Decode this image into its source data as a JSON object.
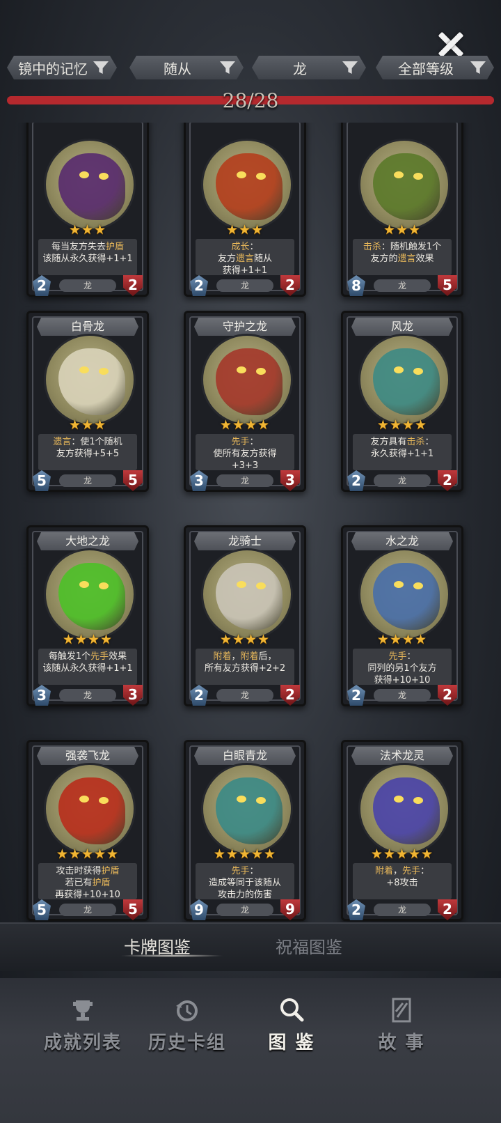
{
  "close_icon": "close-icon",
  "filters": [
    {
      "label": "镜中的记忆",
      "icon": "funnel-icon"
    },
    {
      "label": "随从",
      "icon": "funnel-icon"
    },
    {
      "label": "龙",
      "icon": "funnel-icon"
    },
    {
      "label": "全部等级",
      "icon": "funnel-icon"
    }
  ],
  "collection": {
    "count": "28/28",
    "progress_fraction": 1.0
  },
  "cards": [
    {
      "name": "",
      "stars": 3,
      "desc": [
        {
          "t": "每当友方失去"
        },
        {
          "t": "护盾",
          "k": 1
        },
        {
          "t": "\n该随从永久获得+1+1"
        }
      ],
      "cost": "2",
      "hp": "2",
      "tribe": "龙",
      "color": "#5a2d6e"
    },
    {
      "name": "",
      "stars": 3,
      "desc": [
        {
          "t": "成长",
          "k": 1
        },
        {
          "t": "：\n友方"
        },
        {
          "t": "遗言",
          "k": 1
        },
        {
          "t": "随从\n获得+1+1"
        }
      ],
      "cost": "2",
      "hp": "2",
      "tribe": "龙",
      "color": "#b3401f"
    },
    {
      "name": "",
      "stars": 3,
      "desc": [
        {
          "t": "击杀",
          "k": 1
        },
        {
          "t": "：随机触发1个\n友方的"
        },
        {
          "t": "遗言",
          "k": 1
        },
        {
          "t": "效果"
        }
      ],
      "cost": "8",
      "hp": "5",
      "tribe": "龙",
      "color": "#5d7a2c"
    },
    {
      "name": "白骨龙",
      "stars": 3,
      "desc": [
        {
          "t": "遗言",
          "k": 1
        },
        {
          "t": "：使1个随机\n友方获得+5+5"
        }
      ],
      "cost": "5",
      "hp": "5",
      "tribe": "龙",
      "color": "#d8d2b8"
    },
    {
      "name": "守护之龙",
      "stars": 4,
      "desc": [
        {
          "t": "先手",
          "k": 1
        },
        {
          "t": "：\n使所有友方获得\n+3+3"
        }
      ],
      "cost": "3",
      "hp": "3",
      "tribe": "龙",
      "color": "#a43a2c"
    },
    {
      "name": "风龙",
      "stars": 4,
      "desc": [
        {
          "t": "友方具有"
        },
        {
          "t": "击杀",
          "k": 1
        },
        {
          "t": "：\n永久获得+1+1"
        }
      ],
      "cost": "2",
      "hp": "2",
      "tribe": "龙",
      "color": "#3f8a84"
    },
    {
      "name": "大地之龙",
      "stars": 4,
      "desc": [
        {
          "t": "每触发1个"
        },
        {
          "t": "先手",
          "k": 1
        },
        {
          "t": "效果\n该随从永久获得+1+1"
        }
      ],
      "cost": "3",
      "hp": "3",
      "tribe": "龙",
      "color": "#4fbf2a"
    },
    {
      "name": "龙骑士",
      "stars": 4,
      "desc": [
        {
          "t": "附着",
          "k": 1
        },
        {
          "t": "，"
        },
        {
          "t": "附着",
          "k": 1
        },
        {
          "t": "后，\n所有友方获得+2+2"
        }
      ],
      "cost": "2",
      "hp": "2",
      "tribe": "龙",
      "color": "#c9c4b6"
    },
    {
      "name": "水之龙",
      "stars": 4,
      "desc": [
        {
          "t": "先手",
          "k": 1
        },
        {
          "t": "：\n同列的另1个友方\n获得+10+10"
        }
      ],
      "cost": "2",
      "hp": "2",
      "tribe": "龙",
      "color": "#4a6fa8"
    },
    {
      "name": "强袭飞龙",
      "stars": 5,
      "desc": [
        {
          "t": "攻击时获得"
        },
        {
          "t": "护盾",
          "k": 1
        },
        {
          "t": "\n若已有"
        },
        {
          "t": "护盾",
          "k": 1
        },
        {
          "t": "\n再获得+10+10"
        }
      ],
      "cost": "5",
      "hp": "5",
      "tribe": "龙",
      "color": "#b8301e"
    },
    {
      "name": "白眼青龙",
      "stars": 5,
      "desc": [
        {
          "t": "先手",
          "k": 1
        },
        {
          "t": "：\n造成等同于该随从\n攻击力的伤害"
        }
      ],
      "cost": "9",
      "hp": "9",
      "tribe": "龙",
      "color": "#3d8a86"
    },
    {
      "name": "法术龙灵",
      "stars": 5,
      "desc": [
        {
          "t": "附着",
          "k": 1
        },
        {
          "t": "，"
        },
        {
          "t": "先手",
          "k": 1
        },
        {
          "t": "：\n+8攻击"
        }
      ],
      "cost": "2",
      "hp": "2",
      "tribe": "龙",
      "color": "#4b45a8"
    }
  ],
  "subtabs": {
    "active": "卡牌图鉴",
    "inactive": "祝福图鉴"
  },
  "nav": [
    {
      "label": "成就列表",
      "icon": "trophy-icon",
      "active": false
    },
    {
      "label": "历史卡组",
      "icon": "history-icon",
      "active": false
    },
    {
      "label": "图 鉴",
      "icon": "magnifier-icon",
      "active": true
    },
    {
      "label": "故 事",
      "icon": "book-icon",
      "active": false
    }
  ]
}
